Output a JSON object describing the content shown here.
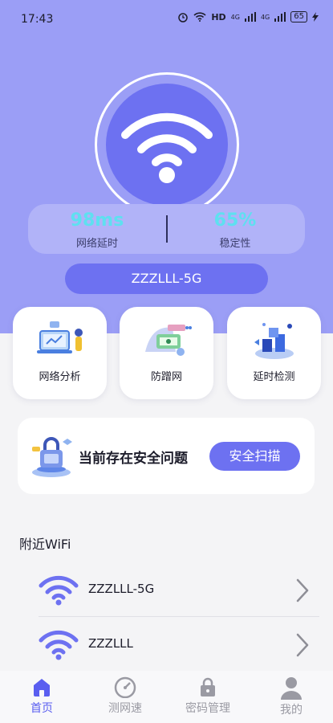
{
  "status_bar": {
    "time": "17:43",
    "hd": "HD",
    "network_1": "4G",
    "network_2": "4G",
    "battery": "65"
  },
  "hero": {
    "latency_value": "98ms",
    "latency_label": "网络延时",
    "stability_value": "65%",
    "stability_label": "稳定性",
    "ssid": "ZZZLLL-5G"
  },
  "features": [
    {
      "label": "网络分析",
      "icon": "network-analysis-icon"
    },
    {
      "label": "防蹭网",
      "icon": "anti-leech-icon"
    },
    {
      "label": "延时检测",
      "icon": "latency-test-icon"
    }
  ],
  "security": {
    "message": "当前存在安全问题",
    "button_label": "安全扫描"
  },
  "nearby": {
    "title": "附近WiFi",
    "networks": [
      {
        "ssid": "ZZZLLL-5G"
      },
      {
        "ssid": "ZZZLLL"
      }
    ]
  },
  "tabs": [
    {
      "label": "首页",
      "icon": "home-icon",
      "active": true
    },
    {
      "label": "测网速",
      "icon": "speedometer-icon"
    },
    {
      "label": "密码管理",
      "icon": "lock-icon"
    },
    {
      "label": "我的",
      "icon": "user-icon"
    }
  ],
  "colors": {
    "hero_bg": "#9b9ef6",
    "accent": "#6d71f1",
    "stat_value": "#5ee0f0",
    "active_tab": "#5a5ef0"
  }
}
